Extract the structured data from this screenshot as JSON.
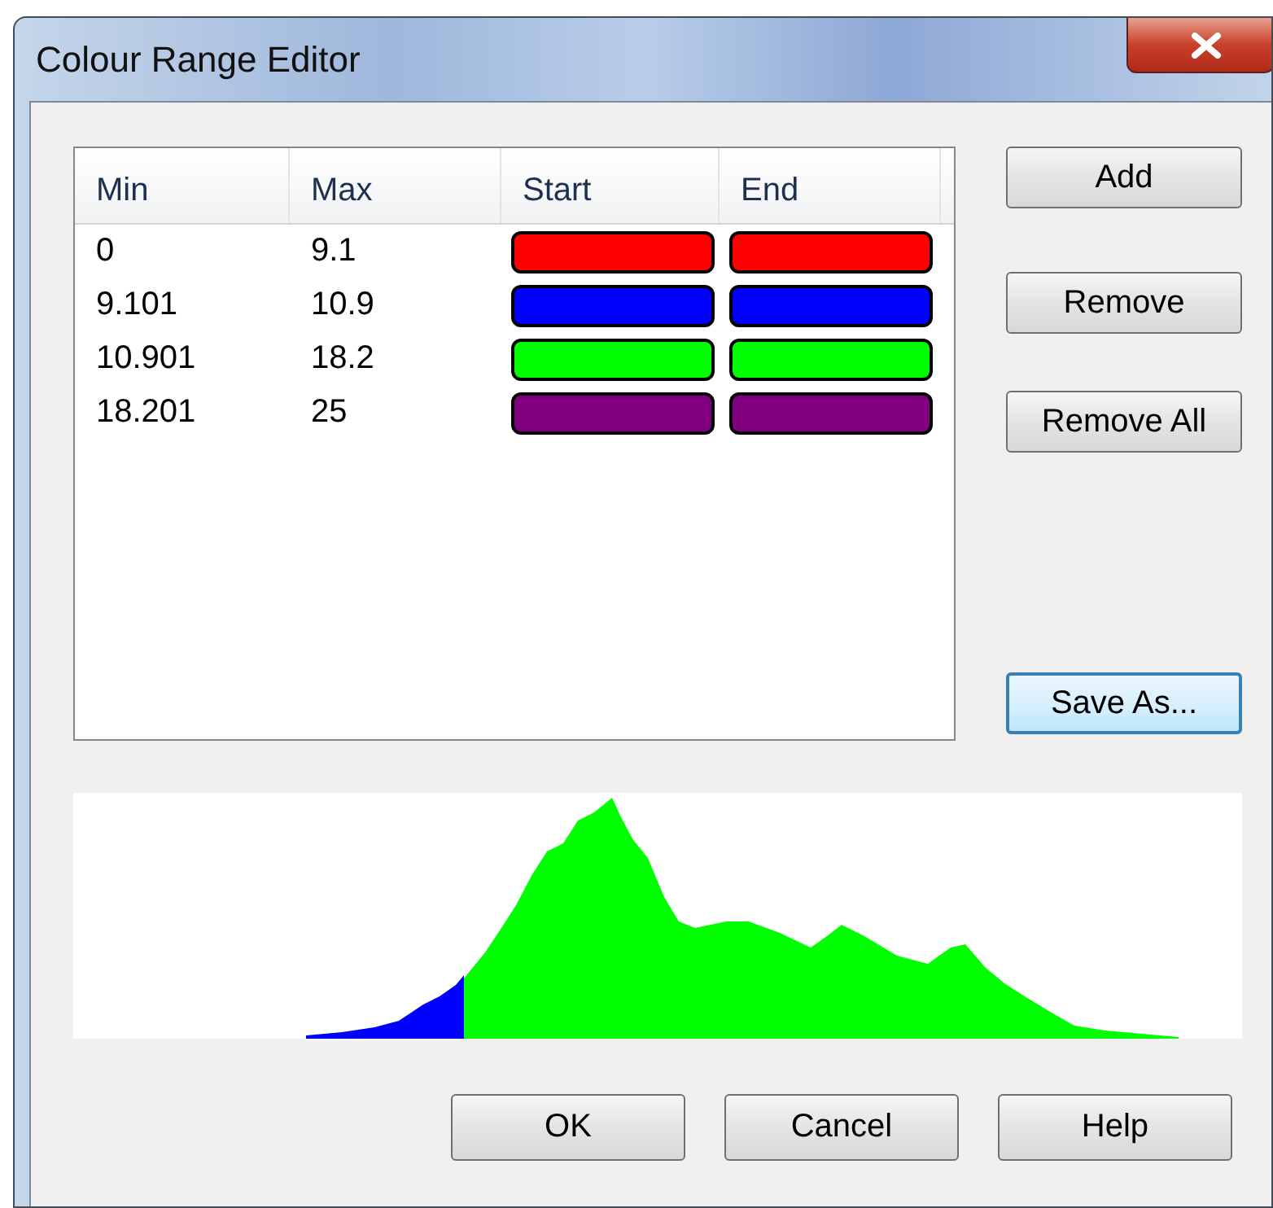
{
  "window": {
    "title": "Colour Range Editor"
  },
  "table": {
    "columns": [
      "Min",
      "Max",
      "Start",
      "End"
    ],
    "rows": [
      {
        "min": "0",
        "max": "9.1",
        "start": {
          "color": "#ff0000"
        },
        "end": {
          "color": "#ff0000"
        }
      },
      {
        "min": "9.101",
        "max": "10.9",
        "start": {
          "color": "#0000ff"
        },
        "end": {
          "color": "#0000ff"
        }
      },
      {
        "min": "10.901",
        "max": "18.2",
        "start": {
          "color": "#00ff00"
        },
        "end": {
          "color": "#00ff00"
        }
      },
      {
        "min": "18.201",
        "max": "25",
        "start": {
          "color": "#800080"
        },
        "end": {
          "color": "#800080"
        }
      }
    ]
  },
  "side_buttons": [
    {
      "label": "Add",
      "focused": false
    },
    {
      "label": "Remove",
      "focused": false
    },
    {
      "label": "Remove All",
      "focused": false
    },
    {
      "label": "Save As...",
      "focused": true
    }
  ],
  "bottom_buttons": [
    "OK",
    "Cancel",
    "Help"
  ]
}
